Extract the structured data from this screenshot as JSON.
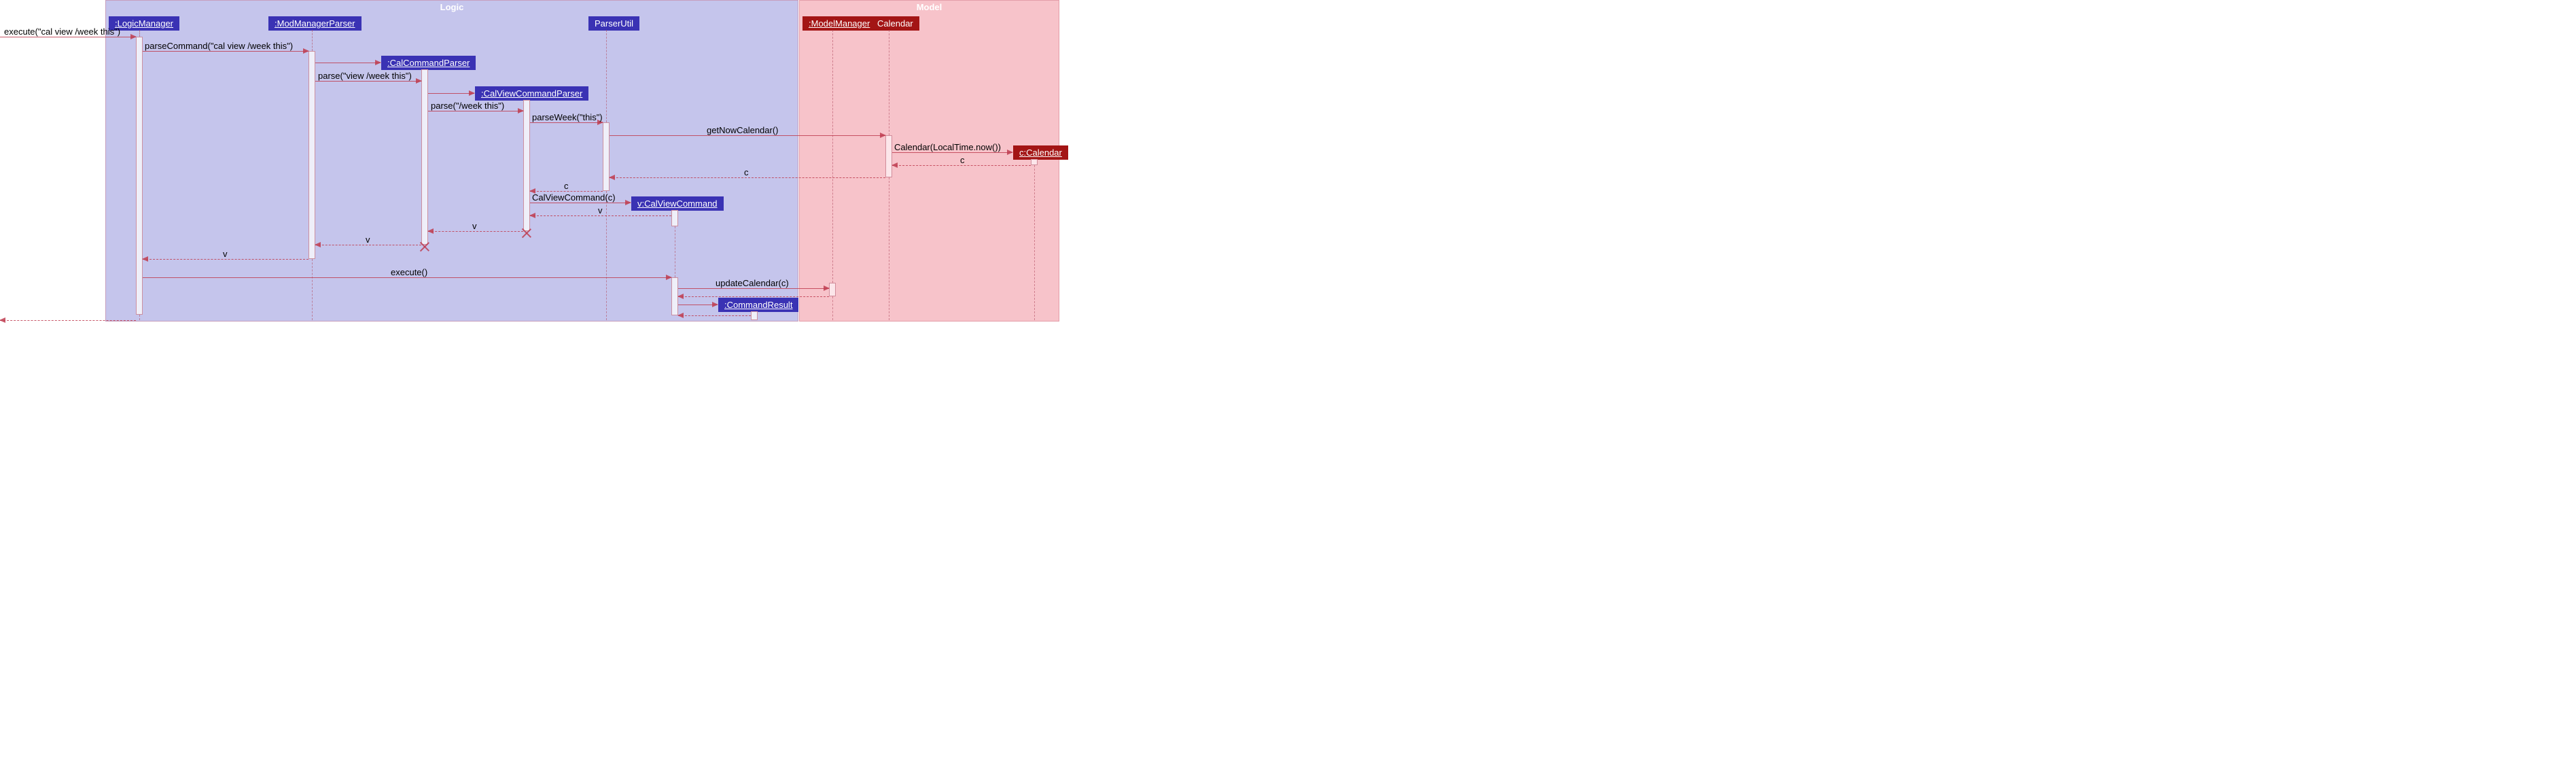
{
  "frames": {
    "logic": "Logic",
    "model": "Model"
  },
  "participants": {
    "logicManager": ":LogicManager",
    "modManagerParser": ":ModManagerParser",
    "calCommandParser": ":CalCommandParser",
    "calViewCommandParser": ":CalViewCommandParser",
    "parserUtil": "ParserUtil",
    "calViewCommand": "v:CalViewCommand",
    "commandResult": ":CommandResult",
    "modelManager": ":ModelManager",
    "calendarClass": "Calendar",
    "calendarInstance": "c:Calendar"
  },
  "messages": {
    "m1": "execute(\"cal view /week this\")",
    "m2": "parseCommand(\"cal view /week this\")",
    "m3": "parse(\"view /week this\")",
    "m4": "parse(\"/week this\")",
    "m5": "parseWeek(\"this\")",
    "m6": "getNowCalendar()",
    "m7": "Calendar(LocalTime.now())",
    "r1": "c",
    "r2": "c",
    "r3": "c",
    "m8": "CalViewCommand(c)",
    "r4": "v",
    "r5": "v",
    "r6": "v",
    "r7": "v",
    "m9": "execute()",
    "m10": "updateCalendar(c)"
  },
  "chart_data": {
    "type": "uml-sequence-diagram",
    "frames": [
      {
        "name": "Logic",
        "participants": [
          ":LogicManager",
          ":ModManagerParser",
          ":CalCommandParser",
          ":CalViewCommandParser",
          "ParserUtil",
          "v:CalViewCommand",
          ":CommandResult"
        ]
      },
      {
        "name": "Model",
        "participants": [
          ":ModelManager",
          "Calendar",
          "c:Calendar"
        ]
      }
    ],
    "participants": [
      {
        "id": "caller",
        "label": "",
        "created_at": 0,
        "frame": null
      },
      {
        "id": "logicManager",
        "label": ":LogicManager",
        "created_at": 0,
        "frame": "Logic"
      },
      {
        "id": "modManagerParser",
        "label": ":ModManagerParser",
        "created_at": 0,
        "frame": "Logic"
      },
      {
        "id": "calCommandParser",
        "label": ":CalCommandParser",
        "created_at": "m3",
        "destroyed_at": "r6",
        "frame": "Logic"
      },
      {
        "id": "calViewCommandParser",
        "label": ":CalViewCommandParser",
        "created_at": "m4",
        "destroyed_at": "r5",
        "frame": "Logic"
      },
      {
        "id": "parserUtil",
        "label": "ParserUtil",
        "created_at": 0,
        "frame": "Logic"
      },
      {
        "id": "calViewCommand",
        "label": "v:CalViewCommand",
        "created_at": "m8",
        "frame": "Logic"
      },
      {
        "id": "commandResult",
        "label": ":CommandResult",
        "created_at": "after m10",
        "frame": "Logic"
      },
      {
        "id": "modelManager",
        "label": ":ModelManager",
        "created_at": 0,
        "frame": "Model"
      },
      {
        "id": "calendarClass",
        "label": "Calendar",
        "created_at": 0,
        "frame": "Model"
      },
      {
        "id": "calendarInstance",
        "label": "c:Calendar",
        "created_at": "m7",
        "frame": "Model"
      }
    ],
    "messages": [
      {
        "id": "m1",
        "from": "caller",
        "to": "logicManager",
        "label": "execute(\"cal view /week this\")",
        "type": "sync"
      },
      {
        "id": "m2",
        "from": "logicManager",
        "to": "modManagerParser",
        "label": "parseCommand(\"cal view /week this\")",
        "type": "sync"
      },
      {
        "id": "m3",
        "from": "modManagerParser",
        "to": "calCommandParser",
        "label": "parse(\"view /week this\")",
        "type": "create"
      },
      {
        "id": "m4",
        "from": "calCommandParser",
        "to": "calViewCommandParser",
        "label": "parse(\"/week this\")",
        "type": "create"
      },
      {
        "id": "m5",
        "from": "calViewCommandParser",
        "to": "parserUtil",
        "label": "parseWeek(\"this\")",
        "type": "sync"
      },
      {
        "id": "m6",
        "from": "parserUtil",
        "to": "calendarClass",
        "label": "getNowCalendar()",
        "type": "sync"
      },
      {
        "id": "m7",
        "from": "calendarClass",
        "to": "calendarInstance",
        "label": "Calendar(LocalTime.now())",
        "type": "create"
      },
      {
        "id": "r1",
        "from": "calendarInstance",
        "to": "calendarClass",
        "label": "c",
        "type": "return"
      },
      {
        "id": "r2",
        "from": "calendarClass",
        "to": "parserUtil",
        "label": "c",
        "type": "return"
      },
      {
        "id": "r3",
        "from": "parserUtil",
        "to": "calViewCommandParser",
        "label": "c",
        "type": "return"
      },
      {
        "id": "m8",
        "from": "calViewCommandParser",
        "to": "calViewCommand",
        "label": "CalViewCommand(c)",
        "type": "create"
      },
      {
        "id": "r4",
        "from": "calViewCommand",
        "to": "calViewCommandParser",
        "label": "v",
        "type": "return"
      },
      {
        "id": "r5",
        "from": "calViewCommandParser",
        "to": "calCommandParser",
        "label": "v",
        "type": "return"
      },
      {
        "id": "r6",
        "from": "calCommandParser",
        "to": "modManagerParser",
        "label": "v",
        "type": "return"
      },
      {
        "id": "r7",
        "from": "modManagerParser",
        "to": "logicManager",
        "label": "v",
        "type": "return"
      },
      {
        "id": "m9",
        "from": "logicManager",
        "to": "calViewCommand",
        "label": "execute()",
        "type": "sync"
      },
      {
        "id": "m10",
        "from": "calViewCommand",
        "to": "modelManager",
        "label": "updateCalendar(c)",
        "type": "sync"
      },
      {
        "id": "cr",
        "from": "calViewCommand",
        "to": "commandResult",
        "label": "",
        "type": "create"
      }
    ]
  }
}
